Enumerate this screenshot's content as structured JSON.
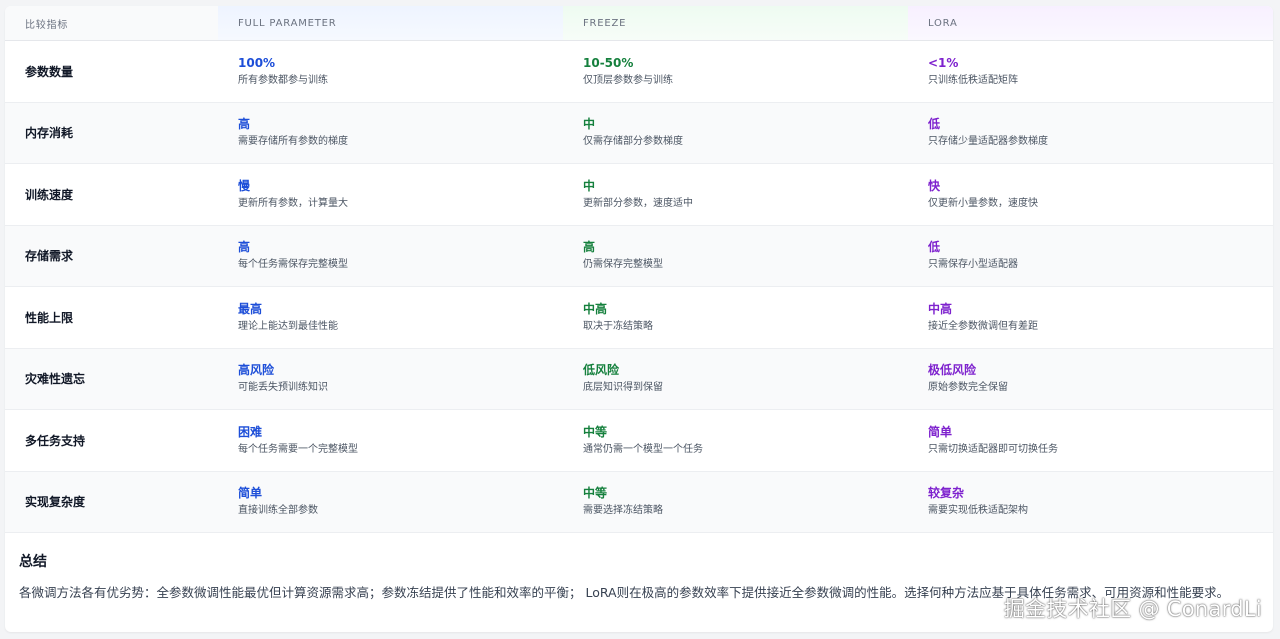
{
  "table": {
    "headers": [
      "比较指标",
      "FULL PARAMETER",
      "FREEZE",
      "LORA"
    ],
    "rows": [
      {
        "metric": "参数数量",
        "full": {
          "value": "100%",
          "desc": "所有参数都参与训练"
        },
        "freeze": {
          "value": "10-50%",
          "desc": "仅顶层参数参与训练"
        },
        "lora": {
          "value": "<1%",
          "desc": "只训练低秩适配矩阵"
        }
      },
      {
        "metric": "内存消耗",
        "full": {
          "value": "高",
          "desc": "需要存储所有参数的梯度"
        },
        "freeze": {
          "value": "中",
          "desc": "仅需存储部分参数梯度"
        },
        "lora": {
          "value": "低",
          "desc": "只存储少量适配器参数梯度"
        }
      },
      {
        "metric": "训练速度",
        "full": {
          "value": "慢",
          "desc": "更新所有参数，计算量大"
        },
        "freeze": {
          "value": "中",
          "desc": "更新部分参数，速度适中"
        },
        "lora": {
          "value": "快",
          "desc": "仅更新小量参数，速度快"
        }
      },
      {
        "metric": "存储需求",
        "full": {
          "value": "高",
          "desc": "每个任务需保存完整模型"
        },
        "freeze": {
          "value": "高",
          "desc": "仍需保存完整模型"
        },
        "lora": {
          "value": "低",
          "desc": "只需保存小型适配器"
        }
      },
      {
        "metric": "性能上限",
        "full": {
          "value": "最高",
          "desc": "理论上能达到最佳性能"
        },
        "freeze": {
          "value": "中高",
          "desc": "取决于冻结策略"
        },
        "lora": {
          "value": "中高",
          "desc": "接近全参数微调但有差距"
        }
      },
      {
        "metric": "灾难性遗忘",
        "full": {
          "value": "高风险",
          "desc": "可能丢失预训练知识"
        },
        "freeze": {
          "value": "低风险",
          "desc": "底层知识得到保留"
        },
        "lora": {
          "value": "极低风险",
          "desc": "原始参数完全保留"
        }
      },
      {
        "metric": "多任务支持",
        "full": {
          "value": "困难",
          "desc": "每个任务需要一个完整模型"
        },
        "freeze": {
          "value": "中等",
          "desc": "通常仍需一个模型一个任务"
        },
        "lora": {
          "value": "简单",
          "desc": "只需切换适配器即可切换任务"
        }
      },
      {
        "metric": "实现复杂度",
        "full": {
          "value": "简单",
          "desc": "直接训练全部参数"
        },
        "freeze": {
          "value": "中等",
          "desc": "需要选择冻结策略"
        },
        "lora": {
          "value": "较复杂",
          "desc": "需要实现低秩适配架构"
        }
      }
    ]
  },
  "summary": {
    "title": "总结",
    "text": "各微调方法各有优劣势：全参数微调性能最优但计算资源需求高；参数冻结提供了性能和效率的平衡； LoRA则在极高的参数效率下提供接近全参数微调的性能。选择何种方法应基于具体任务需求、可用资源和性能要求。"
  },
  "watermark": "掘金技术社区 @ ConardLi",
  "colors": {
    "full": "#1d4ed8",
    "freeze": "#15803d",
    "lora": "#7e22ce"
  }
}
